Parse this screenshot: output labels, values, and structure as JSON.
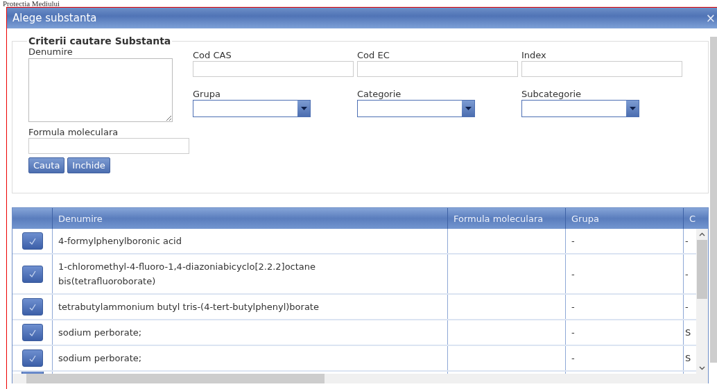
{
  "page_header": {
    "text": "Protectia Mediului"
  },
  "dialog": {
    "title": "Alege substanta",
    "close": "×"
  },
  "criteria": {
    "legend": "Criterii cautare Substanta",
    "name_field": {
      "label": "Denumire"
    },
    "text_fields": [
      {
        "label": "Cod CAS"
      },
      {
        "label": "Cod EC"
      },
      {
        "label": "Index"
      }
    ],
    "dropdowns": [
      {
        "label": "Grupa"
      },
      {
        "label": "Categorie"
      },
      {
        "label": "Subcategorie"
      }
    ],
    "formula_field": {
      "label": "Formula moleculara"
    },
    "buttons": [
      "Cauta",
      "Inchide"
    ]
  },
  "table": {
    "columns": [
      "Denumire",
      "Formula moleculara",
      "Grupa",
      "C"
    ],
    "rows": [
      {
        "denumire": "4-formylphenylboronic acid",
        "formula": "",
        "grupa": "-",
        "column_4": "-"
      },
      {
        "denumire": "1-chloromethyl-4-fluoro-1,4-diazoniabicyclo[2.2.2]octane bis(tetrafluoroborate)",
        "formula": "",
        "grupa": "-",
        "column_4": "-"
      },
      {
        "denumire": "tetrabutylammonium butyl tris-(4-tert-butylphenyl)borate",
        "formula": "",
        "grupa": "-",
        "column_4": "-"
      },
      {
        "denumire": "sodium perborate;",
        "formula": "",
        "grupa": "-",
        "column_4": "S"
      },
      {
        "denumire": "sodium perborate;",
        "formula": "",
        "grupa": "-",
        "column_4": "S"
      }
    ]
  }
}
